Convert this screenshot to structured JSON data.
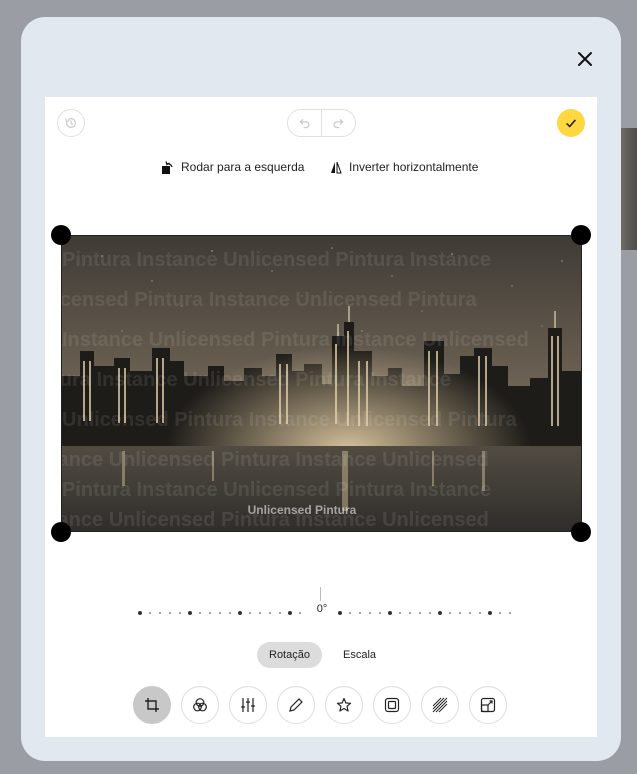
{
  "toolbar": {
    "reset_icon": "history-icon",
    "undo_icon": "undo-icon",
    "redo_icon": "redo-icon",
    "done_icon": "check-icon",
    "accent": "#ffd740"
  },
  "actions": {
    "rotate_left": "Rodar para a esquerda",
    "flip_horizontal": "Inverter horizontalmente"
  },
  "image": {
    "watermark": "Unlicensed Pintura"
  },
  "rotation": {
    "value": "0°"
  },
  "tabs": [
    {
      "label": "Rotação",
      "active": true
    },
    {
      "label": "Escala",
      "active": false
    }
  ],
  "tools": [
    {
      "icon": "crop-icon",
      "active": true
    },
    {
      "icon": "filter-icon",
      "active": false
    },
    {
      "icon": "adjust-sliders-icon",
      "active": false
    },
    {
      "icon": "pencil-icon",
      "active": false
    },
    {
      "icon": "star-icon",
      "active": false
    },
    {
      "icon": "frame-icon",
      "active": false
    },
    {
      "icon": "texture-icon",
      "active": false
    },
    {
      "icon": "resize-icon",
      "active": false
    }
  ]
}
